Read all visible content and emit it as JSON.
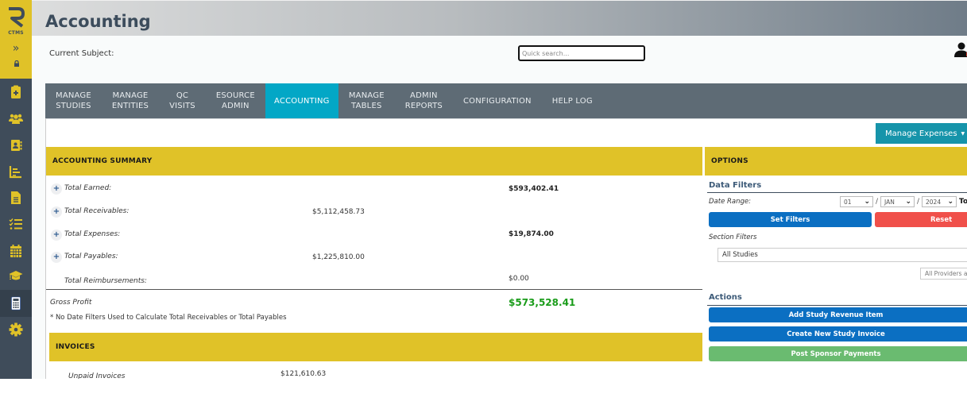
{
  "sidebar": {
    "logo_letter": "R",
    "logo_text": "CTMS",
    "expand_glyph": "»",
    "items": [
      {
        "icon": "clipboard-plus-icon"
      },
      {
        "icon": "users-icon"
      },
      {
        "icon": "contact-book-icon"
      },
      {
        "icon": "bar-chart-icon"
      },
      {
        "icon": "document-icon"
      },
      {
        "icon": "checklist-icon"
      },
      {
        "icon": "calendar-icon"
      },
      {
        "icon": "graduation-cap-icon"
      },
      {
        "icon": "calculator-icon",
        "active": true
      },
      {
        "icon": "gear-icon"
      }
    ],
    "accent_color": "#e0c228"
  },
  "header": {
    "title": "Accounting",
    "current_subject_label": "Current Subject:",
    "search_placeholder": "Quick search..."
  },
  "nav": {
    "tabs": [
      {
        "line1": "MANAGE",
        "line2": "STUDIES"
      },
      {
        "line1": "MANAGE",
        "line2": "ENTITIES"
      },
      {
        "line1": "QC",
        "line2": "VISITS"
      },
      {
        "line1": "ESOURCE",
        "line2": "ADMIN"
      },
      {
        "line1": "ACCOUNTING",
        "line2": "",
        "active": true
      },
      {
        "line1": "MANAGE",
        "line2": "TABLES"
      },
      {
        "line1": "ADMIN",
        "line2": "REPORTS"
      },
      {
        "line1": "CONFIGURATION",
        "line2": ""
      },
      {
        "line1": "HELP LOG",
        "line2": ""
      }
    ],
    "active_color": "#03a7c6"
  },
  "toolbar": {
    "manage_expenses_label": "Manage Expenses",
    "caret": "▼"
  },
  "summary": {
    "title": "ACCOUNTING SUMMARY",
    "rows": [
      {
        "label": "Total Earned:",
        "value": "$593,402.41",
        "expandable": true
      },
      {
        "label": "Total Receivables:",
        "value": "$5,112,458.73",
        "expandable": true
      },
      {
        "label": "Total Expenses:",
        "value": "$19,874.00",
        "expandable": true
      },
      {
        "label": "Total Payables:",
        "value": "$1,225,810.00",
        "expandable": true
      },
      {
        "label": "Total Reimbursements:",
        "value": "$0.00",
        "expandable": false
      }
    ],
    "gross_profit_label": "Gross Profit",
    "gross_profit_value": "$573,528.41",
    "note": "* No Date Filters Used to Calculate Total Receivables or Total Payables"
  },
  "invoices": {
    "title": "INVOICES",
    "rows": [
      {
        "label": "Unpaid Invoices",
        "value": "$121,610.63"
      }
    ]
  },
  "options": {
    "title": "OPTIONS",
    "data_filters_title": "Data Filters",
    "date_range_label": "Date Range:",
    "date_day": "01",
    "date_month": "JAN",
    "date_year": "2024",
    "date_sep": "/",
    "to_label": "To",
    "set_filters_label": "Set Filters",
    "reset_label": "Reset",
    "section_filters_label": "Section Filters",
    "studies_value": "All Studies",
    "providers_value": "All Providers a",
    "actions_title": "Actions",
    "actions": [
      {
        "label": "Add Study Revenue Item",
        "color": "#0b6fc2"
      },
      {
        "label": "Create New Study Invoice",
        "color": "#0b6fc2"
      },
      {
        "label": "Post Sponsor Payments",
        "color": "#6abb70"
      }
    ]
  }
}
